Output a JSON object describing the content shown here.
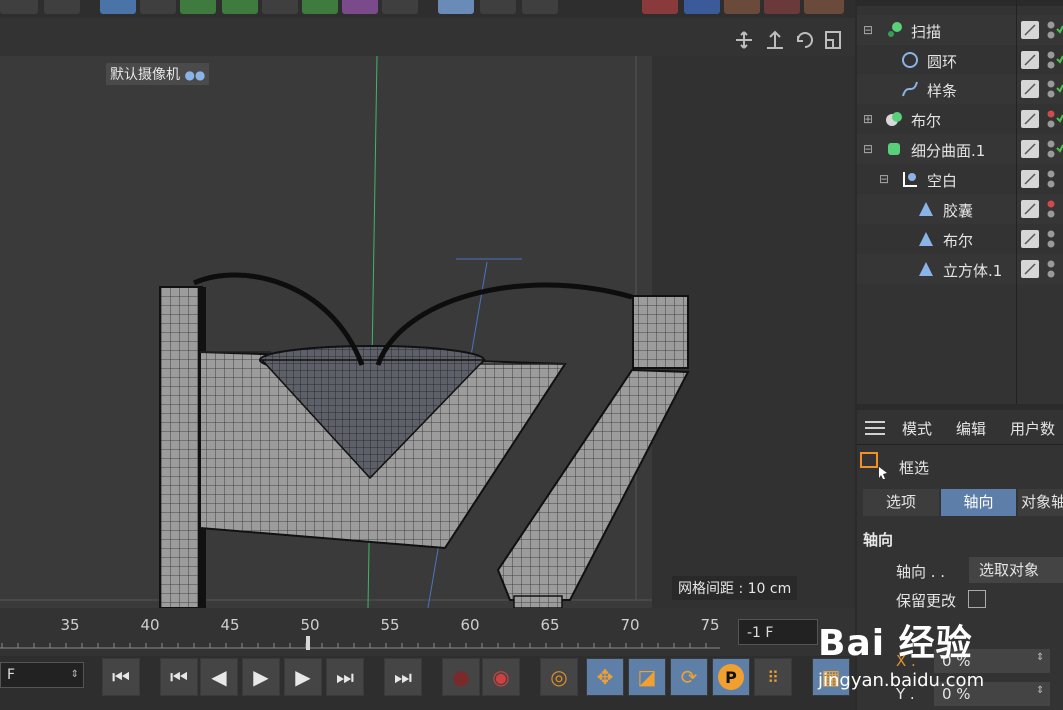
{
  "viewport": {
    "camera_label": "默认摄像机",
    "grid_spacing": "网格间距 : 10 cm"
  },
  "timeline": {
    "ticks": [
      "35",
      "40",
      "45",
      "50",
      "55",
      "60",
      "65",
      "70",
      "75"
    ],
    "current_frame": "-1 F",
    "start_frame": "F"
  },
  "objects": [
    {
      "name": "扫描",
      "icon": "sweep-icon"
    },
    {
      "name": "圆环",
      "icon": "circle-spline-icon"
    },
    {
      "name": "样条",
      "icon": "spline-icon"
    },
    {
      "name": "布尔",
      "icon": "boole-icon"
    },
    {
      "name": "细分曲面.1",
      "icon": "subdivision-surface-icon"
    },
    {
      "name": "空白",
      "icon": "null-icon"
    },
    {
      "name": "胶囊",
      "icon": "capsule-icon"
    },
    {
      "name": "布尔",
      "icon": "boole-icon"
    },
    {
      "name": "立方体.1",
      "icon": "cube-icon"
    }
  ],
  "attributes": {
    "menu": [
      "模式",
      "编辑",
      "用户数"
    ],
    "mode": "框选",
    "tabs": [
      "选项",
      "轴向",
      "对象轴"
    ],
    "active_tab": "轴向",
    "section_title": "轴向",
    "axis_label": "轴向 . .",
    "axis_value": "选取对象",
    "keep_changes_label": "保留更改",
    "x_label": "X .",
    "x_value": "0 %",
    "y_label": "Y .",
    "y_value": "0 %"
  },
  "watermark": {
    "logo": "Bai 经验",
    "url": "jingyan.baidu.com"
  },
  "colors": {
    "accent_blue": "#5d7ea8",
    "panel": "#333333",
    "viewport_bg": "#3a3a3a"
  }
}
